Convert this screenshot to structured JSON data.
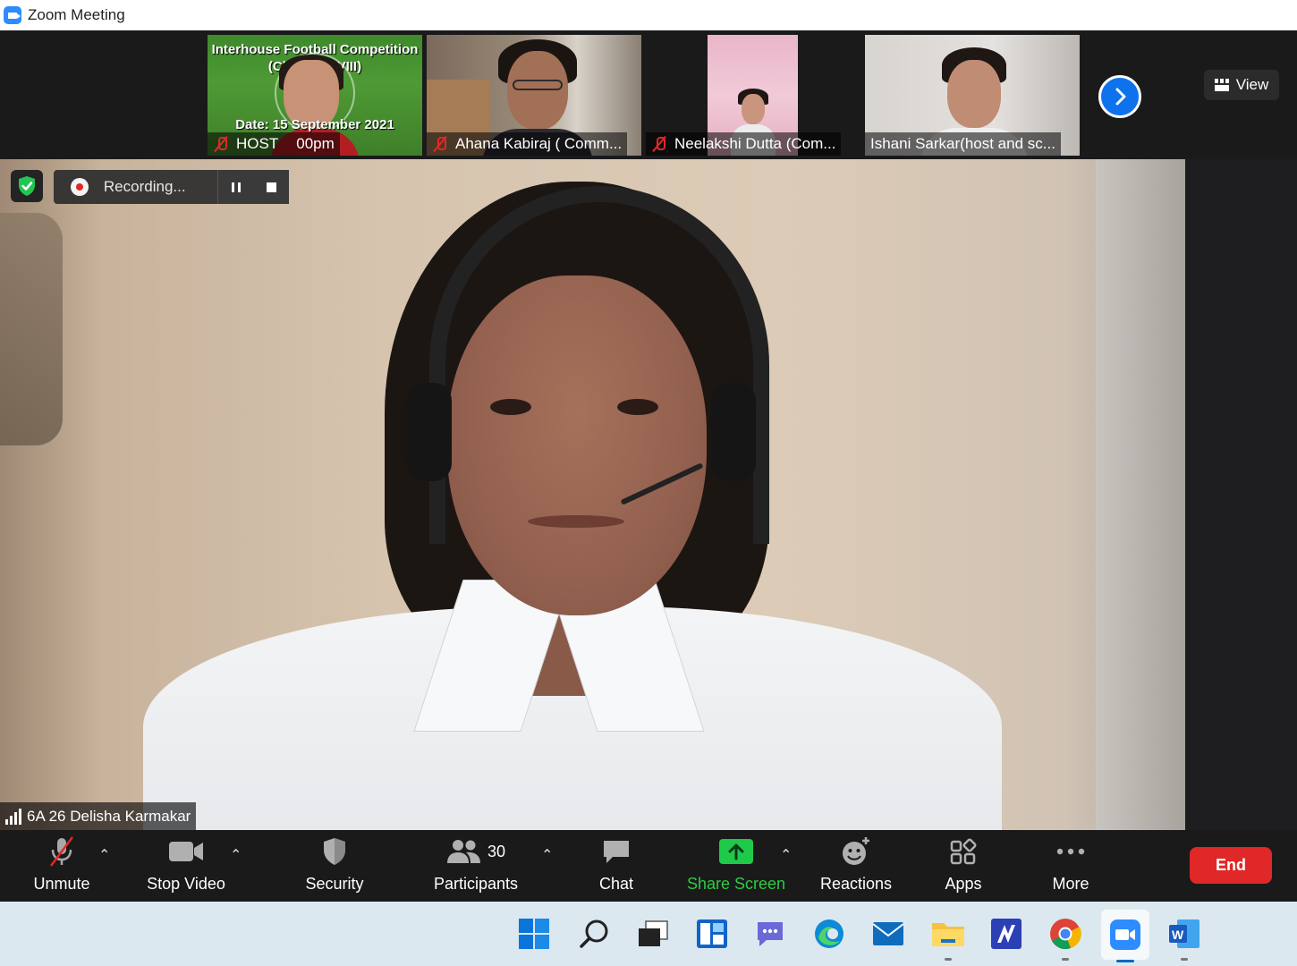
{
  "window": {
    "title": "Zoom Meeting"
  },
  "strip": {
    "tiles": [
      {
        "name": "HOST",
        "muted": true,
        "poster_lines": [
          "Interhouse Football Competition",
          "(Class VI - VIII)",
          "Date: 15 September 2021",
          "00pm"
        ]
      },
      {
        "name": "Ahana Kabiraj ( Comm...",
        "muted": true
      },
      {
        "name": "Neelakshi Dutta (Com...",
        "muted": true
      },
      {
        "name": "Ishani Sarkar(host and sc...",
        "muted": false
      }
    ],
    "view_label": "View"
  },
  "recording": {
    "label": "Recording..."
  },
  "active_speaker": {
    "name": "6A 26 Delisha Karmakar"
  },
  "toolbar": {
    "unmute": "Unmute",
    "stop_video": "Stop Video",
    "security": "Security",
    "participants": "Participants",
    "participants_count": "30",
    "chat": "Chat",
    "share_screen": "Share Screen",
    "reactions": "Reactions",
    "apps": "Apps",
    "more": "More",
    "end": "End"
  },
  "colors": {
    "accent": "#0e72ed",
    "end": "#e02828",
    "share": "#2ecc40"
  },
  "taskbar": {
    "items": [
      "windows-start-icon",
      "search-icon",
      "task-view-icon",
      "widgets-icon",
      "teams-chat-icon",
      "edge-icon",
      "mail-icon",
      "file-explorer-icon",
      "app-icon",
      "chrome-icon",
      "zoom-icon",
      "word-icon"
    ]
  }
}
